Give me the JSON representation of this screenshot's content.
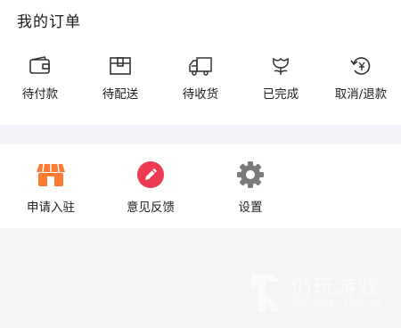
{
  "orders": {
    "title": "我的订单",
    "items": [
      {
        "label": "待付款",
        "icon": "wallet-icon"
      },
      {
        "label": "待配送",
        "icon": "package-box-icon"
      },
      {
        "label": "待收货",
        "icon": "delivery-truck-icon"
      },
      {
        "label": "已完成",
        "icon": "flower-icon"
      },
      {
        "label": "取消/退款",
        "icon": "yen-refund-icon"
      }
    ]
  },
  "services": {
    "items": [
      {
        "label": "申请入驻",
        "icon": "shop-icon",
        "color": "#ff7a33"
      },
      {
        "label": "意见反馈",
        "icon": "pencil-icon",
        "color": "#ee3a52"
      },
      {
        "label": "设置",
        "icon": "gear-icon",
        "color": "#777777"
      }
    ]
  },
  "watermark": {
    "brand_cn": "仍玩游戏",
    "brand_en": "Rengwan Games"
  }
}
